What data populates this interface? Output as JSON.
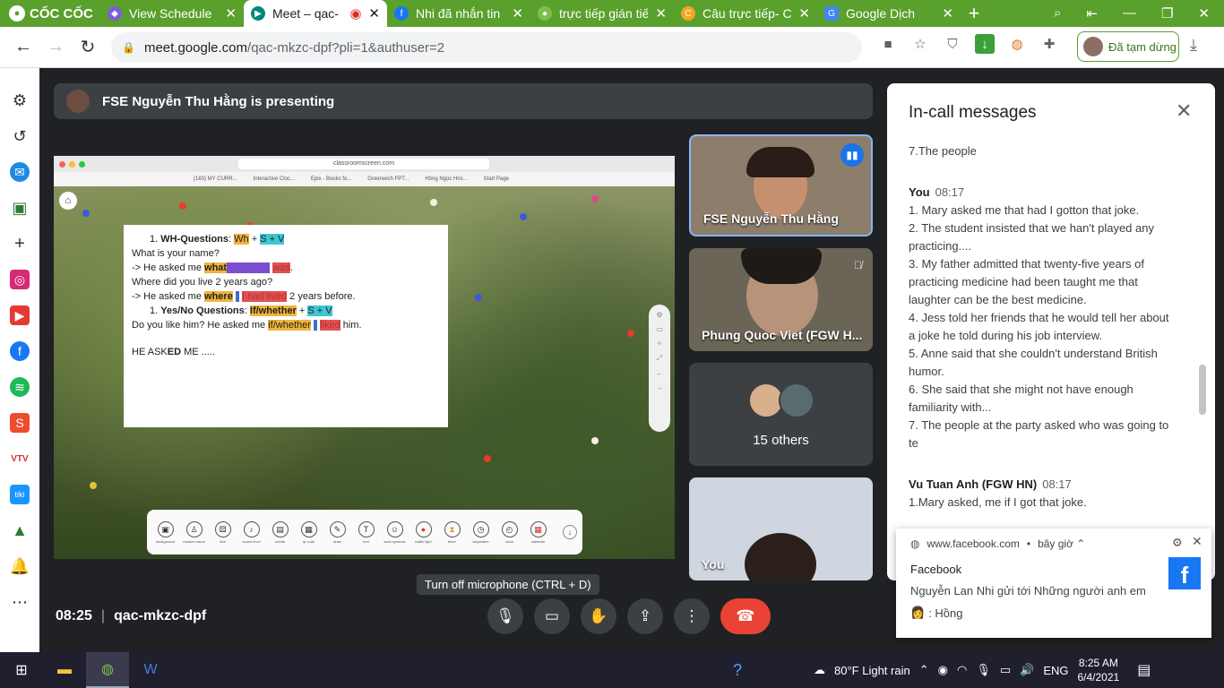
{
  "browser": {
    "logo": "CỐC CỐC",
    "tabs": [
      {
        "title": "View Schedule",
        "color": "#7b5fd6"
      },
      {
        "title": "Meet – qac-",
        "color": "#00897b"
      },
      {
        "title": "Nhi đã nhắn tin",
        "color": "#1877f2"
      },
      {
        "title": "trực tiếp gián tiế",
        "color": "#5aa02c"
      },
      {
        "title": "Câu trực tiếp- C",
        "color": "#f5a623"
      },
      {
        "title": "Google Dịch",
        "color": "#4285f4"
      }
    ],
    "url": "meet.google.com",
    "url_rest": "/qac-mkzc-dpf?pli=1&authuser=2",
    "profile_status": "Đã tạm dừng"
  },
  "meet": {
    "presenting": "FSE Nguyễn Thu Hằng is presenting",
    "slide": {
      "url": "classroomscreen.com",
      "bookmarks": [
        "(183) MY CURR...",
        "Interactive Cloc...",
        "Epix - Books fo...",
        "Greenwich FPT...",
        "Hồng Ngọc Hns...",
        "Start Page"
      ],
      "l1a": "1.  ",
      "l1b": "WH-Questions",
      "l1c": ": ",
      "l1d": "Wh",
      "l1e": " + ",
      "l1f": "S + V",
      "l2": "What is your name?",
      "l3a": "-> He asked me ",
      "l3b": "what",
      "l3c": " my name",
      "l3d": "was",
      "l4": "Where did you live 2 years ago?",
      "l5a": "-> He asked me ",
      "l5b": "where",
      "l5c": "I had lived",
      "l5d": " 2 years before.",
      "l6a": "1.  ",
      "l6b": "Yes/No Questions",
      "l6c": ": ",
      "l6d": "If/whether",
      "l6e": " + ",
      "l6f": "S + V",
      "l7a": "Do you like him? He asked me ",
      "l7b": "if/whether",
      "l7c": "I",
      "l7d": "liked",
      "l7e": " him.",
      "l8a": "HE ASK",
      "l8b": "ED",
      "l8c": " ME .....",
      "dock": [
        "background",
        "random name",
        "dice",
        "sound level",
        "media",
        "qr code",
        "draw",
        "text",
        "work symbols",
        "traffic light",
        "timer",
        "stopwatch",
        "clock",
        "calendar"
      ]
    },
    "tiles": {
      "t1": "FSE Nguyễn Thu Hằng",
      "t2": "Phung Quoc Viet (FGW H...",
      "t3": "15 others",
      "t4": "You"
    },
    "time": "08:25",
    "code": "qac-mkzc-dpf",
    "tooltip": "Turn off microphone (CTRL + D)",
    "panel": {
      "title": "In-call messages",
      "m0": "7.The people",
      "you": "You",
      "you_time": "08:17",
      "you_lines": [
        "1.      Mary asked me that had I gotton that joke.",
        "2.      The student insisted that we han't played any practicing....",
        "3.      My father admitted that twenty-five years of practicing medicine had been taught me that laughter can be the best medicine.",
        "4.      Jess told her friends that he would tell her about a joke he told during his job interview.",
        "5.      Anne said that she couldn't understand British humor.",
        "6.      She said that she might not have enough familiarity with...",
        "7.      The people at the party asked who was going to te"
      ],
      "s2": "Vu Tuan Anh (FGW HN)",
      "s2_time": "08:17",
      "s2_msg": "1.Mary asked, me if I got that joke."
    }
  },
  "notification": {
    "source": "www.facebook.com",
    "when": "bây giờ ⌃",
    "title": "Facebook",
    "body": "Nguyễn Lan Nhi gửi tới Những người anh em",
    "sub": ": Hồng"
  },
  "taskbar": {
    "weather": "80°F  Light rain",
    "lang": "ENG",
    "time": "8:25 AM",
    "date": "6/4/2021"
  }
}
